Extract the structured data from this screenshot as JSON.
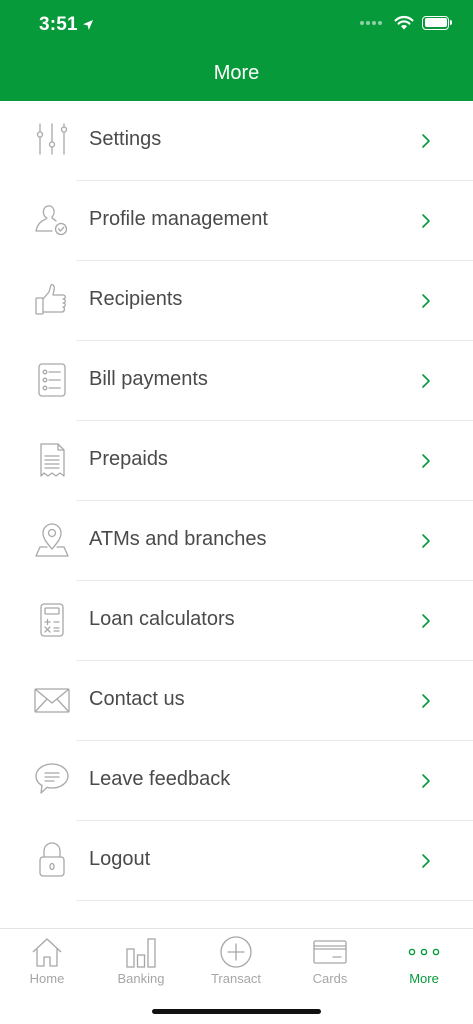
{
  "status_bar": {
    "time": "3:51"
  },
  "header": {
    "title": "More"
  },
  "menu": {
    "items": [
      {
        "label": "Settings",
        "icon": "sliders-icon"
      },
      {
        "label": "Profile management",
        "icon": "user-check-icon"
      },
      {
        "label": "Recipients",
        "icon": "thumbs-up-icon"
      },
      {
        "label": "Bill payments",
        "icon": "checklist-icon"
      },
      {
        "label": "Prepaids",
        "icon": "receipt-icon"
      },
      {
        "label": "ATMs and branches",
        "icon": "map-pin-icon"
      },
      {
        "label": "Loan calculators",
        "icon": "calculator-icon"
      },
      {
        "label": "Contact us",
        "icon": "envelope-icon"
      },
      {
        "label": "Leave feedback",
        "icon": "chat-bubble-icon"
      },
      {
        "label": "Logout",
        "icon": "padlock-icon"
      }
    ]
  },
  "tabbar": {
    "tabs": [
      {
        "label": "Home",
        "icon": "house-icon",
        "active": false
      },
      {
        "label": "Banking",
        "icon": "bar-chart-icon",
        "active": false
      },
      {
        "label": "Transact",
        "icon": "plus-circle-icon",
        "active": false
      },
      {
        "label": "Cards",
        "icon": "card-icon",
        "active": false
      },
      {
        "label": "More",
        "icon": "three-dots-icon",
        "active": true
      }
    ]
  },
  "colors": {
    "brand_green": "#079a3a",
    "icon_gray": "#a8a8a8",
    "text_gray": "#4a4a4a",
    "inactive_tab": "#a6a6a6"
  }
}
